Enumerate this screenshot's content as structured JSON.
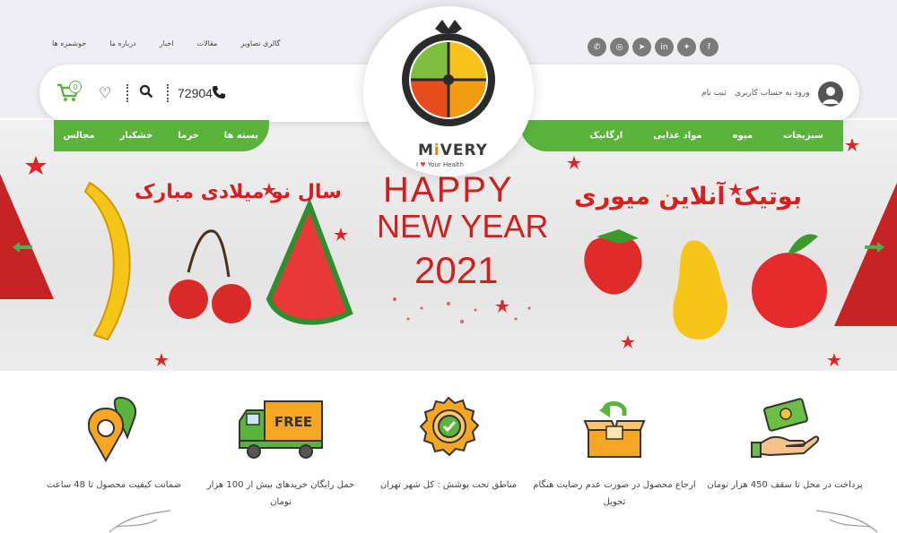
{
  "top_links": [
    "گالری تصاویر",
    "مقالات",
    "اخبار",
    "درباره ما",
    "خوشمزه ها"
  ],
  "social_icons": [
    "facebook-icon",
    "twitter-icon",
    "linkedin-icon",
    "telegram-icon",
    "instagram-icon",
    "whatsapp-icon"
  ],
  "header": {
    "phone": "72904",
    "cart_count": "0",
    "login_label": "ورود به حساب کاربری",
    "signup_label": "ثبت نام"
  },
  "logo": {
    "name_pre": "M",
    "name_i": "i",
    "name_post": "VERY",
    "tagline_pre": "I",
    "tagline_heart": "♥",
    "tagline_post": "Your Health"
  },
  "nav_right": [
    "سبزیجات",
    "میوه",
    "مواد غذایی",
    "ارگانیک"
  ],
  "nav_left": [
    "بسته ها",
    "خرما",
    "خشکبار",
    "مجالس"
  ],
  "banner": {
    "title_right": "بوتیک آنلاین میوری",
    "title_left": "سال نو میلادی مبارک",
    "hny_line1": "HAPPY",
    "hny_line2": "NEW YEAR",
    "hny_line3": "2021"
  },
  "features": [
    {
      "icon": "payment-hand-icon",
      "text": "پرداخت در محل تا سقف 450 هزار تومان"
    },
    {
      "icon": "return-box-icon",
      "text": "ارجاع محصول در صورت عدم رضایت هنگام تحویل"
    },
    {
      "icon": "badge-check-icon",
      "text": "مناطق تحت پوشش : کل شهر تهران"
    },
    {
      "icon": "free-truck-icon",
      "text": "حمل رایگان خریدهای بیش از 100 هزار تومان"
    },
    {
      "icon": "location-pin-icon",
      "text": "ضمانت کیفیت محصول تا 48 ساعت"
    }
  ],
  "free_label": "FREE",
  "colors": {
    "green": "#5ab43c",
    "red": "#d61f1f",
    "orange": "#e8831a",
    "gray": "#7b7b7b"
  }
}
